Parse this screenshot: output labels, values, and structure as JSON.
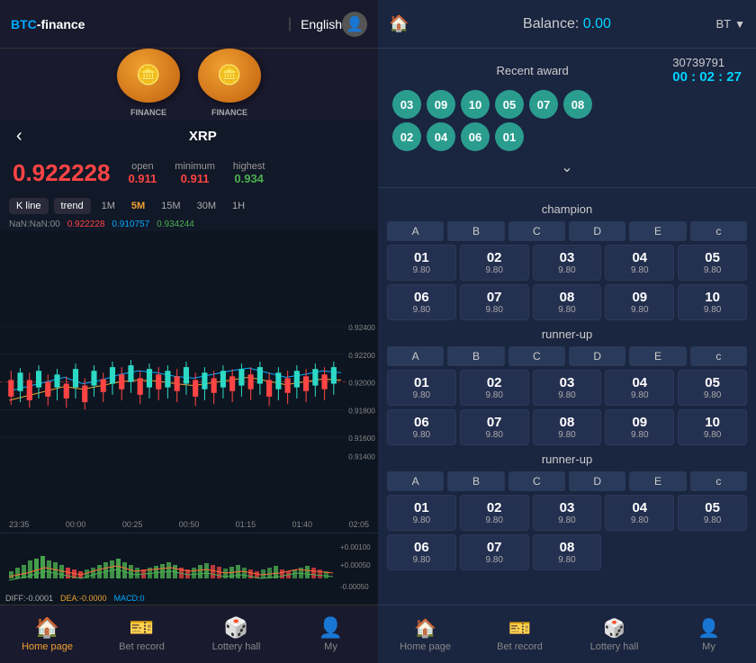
{
  "left": {
    "header": {
      "logo": "BTC-finance",
      "lang": "English",
      "avatar_icon": "👤"
    },
    "banner": {
      "coin1_label": "FINANCE",
      "coin2_label": "FINANCE"
    },
    "coin_name": "XRP",
    "price": {
      "main": "0.922228",
      "open_label": "open",
      "open_val": "0.911",
      "min_label": "minimum",
      "min_val": "0.911",
      "high_label": "highest",
      "high_val": "0.934"
    },
    "chart_controls": {
      "kline": "K line",
      "trend": "trend",
      "times": [
        "1M",
        "15M",
        "30M",
        "1H"
      ],
      "active_time": "5M"
    },
    "chart_info": {
      "nan": "NaN:NaN:00",
      "price1": "0.922228",
      "price2": "0.910757",
      "price3": "0.934244"
    },
    "y_labels": [
      "0.92400",
      "0.92200",
      "0.92000",
      "0.91800",
      "0.91600",
      "0.91400"
    ],
    "x_labels": [
      "23:35",
      "00:00",
      "00:25",
      "00:50",
      "01:15",
      "01:40",
      "02:05"
    ],
    "macd": {
      "labels": [
        "+0.00100",
        "+0.00050",
        "-0.00050"
      ],
      "diff": "DIFF:-0.0001",
      "dea": "DEA:-0.0000",
      "macd_lbl": "MACD:0"
    },
    "bottom_nav": [
      {
        "label": "Home page",
        "icon": "🏠",
        "active": true
      },
      {
        "label": "Bet record",
        "icon": "🎫",
        "active": false
      },
      {
        "label": "Lottery hall",
        "icon": "🎲",
        "active": false
      },
      {
        "label": "My",
        "icon": "👤",
        "active": false
      }
    ]
  },
  "right": {
    "header": {
      "home_icon": "🏠",
      "balance_label": "Balance:",
      "balance_val": "0.00",
      "currency": "BT",
      "dropdown_icon": "▼"
    },
    "recent_award": {
      "title": "Recent award",
      "id": "30739791",
      "timer": "00 : 02 : 27",
      "balls_row1": [
        "03",
        "09",
        "10",
        "05",
        "07",
        "08"
      ],
      "balls_row2": [
        "02",
        "04",
        "06",
        "01"
      ]
    },
    "sections": [
      {
        "title": "champion",
        "col_headers": [
          "A",
          "B",
          "C",
          "D",
          "E",
          "c"
        ],
        "cells": [
          {
            "num": "01",
            "odds": "9.80"
          },
          {
            "num": "02",
            "odds": "9.80"
          },
          {
            "num": "03",
            "odds": "9.80"
          },
          {
            "num": "04",
            "odds": "9.80"
          },
          {
            "num": "05",
            "odds": "9.80"
          },
          {
            "num": "06",
            "odds": "9.80"
          },
          {
            "num": "07",
            "odds": "9.80"
          },
          {
            "num": "08",
            "odds": "9.80"
          },
          {
            "num": "09",
            "odds": "9.80"
          },
          {
            "num": "10",
            "odds": "9.80"
          }
        ]
      },
      {
        "title": "runner-up",
        "col_headers": [
          "A",
          "B",
          "C",
          "D",
          "E",
          "c"
        ],
        "cells": [
          {
            "num": "01",
            "odds": "9.80"
          },
          {
            "num": "02",
            "odds": "9.80"
          },
          {
            "num": "03",
            "odds": "9.80"
          },
          {
            "num": "04",
            "odds": "9.80"
          },
          {
            "num": "05",
            "odds": "9.80"
          },
          {
            "num": "06",
            "odds": "9.80"
          },
          {
            "num": "07",
            "odds": "9.80"
          },
          {
            "num": "08",
            "odds": "9.80"
          },
          {
            "num": "09",
            "odds": "9.80"
          },
          {
            "num": "10",
            "odds": "9.80"
          }
        ]
      },
      {
        "title": "runner-up",
        "col_headers": [
          "A",
          "B",
          "C",
          "D",
          "E",
          "c"
        ],
        "cells": [
          {
            "num": "01",
            "odds": "9.80"
          },
          {
            "num": "02",
            "odds": "9.80"
          },
          {
            "num": "03",
            "odds": "9.80"
          },
          {
            "num": "04",
            "odds": "9.80"
          },
          {
            "num": "05",
            "odds": "9.80"
          },
          {
            "num": "06",
            "odds": "9.80"
          },
          {
            "num": "07",
            "odds": "9.80"
          },
          {
            "num": "08",
            "odds": "9.80"
          }
        ]
      }
    ],
    "bottom_nav": [
      {
        "label": "Home page",
        "icon": "🏠",
        "active": false
      },
      {
        "label": "Bet record",
        "icon": "🎫",
        "active": false
      },
      {
        "label": "Lottery hall",
        "icon": "🎲",
        "active": false
      },
      {
        "label": "My",
        "icon": "👤",
        "active": false
      }
    ]
  }
}
